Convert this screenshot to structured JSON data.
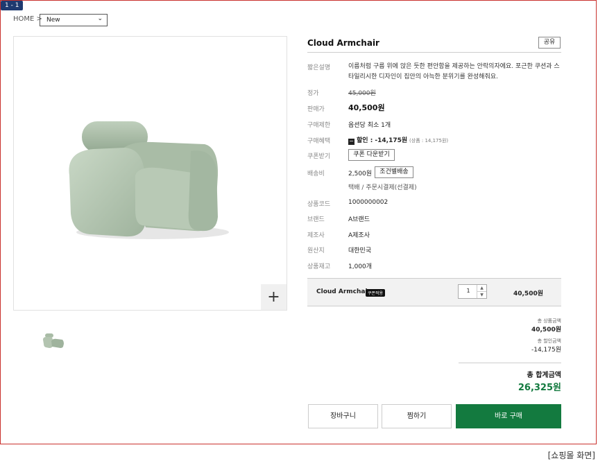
{
  "screen_tag": "1 - 1",
  "caption": "[쇼핑몰 화면]",
  "breadcrumb": {
    "home": "HOME >",
    "category": "New"
  },
  "product": {
    "title": "Cloud Armchair",
    "share_label": "공유",
    "rows": {
      "desc_label": "짧은설명",
      "desc": "이름처럼 구름 위에 앉은 듯한 편안함을 제공하는 안락의자에요. 포근한 쿠션과 스타일리시한 디자인이 집안의 아늑한 분위기를 완성해줘요.",
      "list_price_label": "정가",
      "list_price": "45,000원",
      "sale_price_label": "판매가",
      "sale_price": "40,500원",
      "limit_label": "구매제한",
      "limit": "옵션당 최소 1개",
      "benefit_label": "구매혜택",
      "benefit": "할인 : -14,175원",
      "benefit_detail": "(상품 : 14,175원)",
      "coupon_label": "쿠폰받기",
      "coupon_button": "쿠폰 다운받기",
      "shipping_label": "배송비",
      "shipping_fee": "2,500원",
      "shipping_button": "조건별배송",
      "shipping_method": "택배  / 주문시결제(선결제)",
      "code_label": "상품코드",
      "code": "1000000002",
      "brand_label": "브랜드",
      "brand": "A브랜드",
      "maker_label": "제조사",
      "maker": "A제조사",
      "origin_label": "원산지",
      "origin": "대한민국",
      "stock_label": "상품재고",
      "stock": "1,000개"
    }
  },
  "option": {
    "name": "Cloud Armchair",
    "badge": "쿠폰적용",
    "qty": "1",
    "price": "40,500원"
  },
  "summary": {
    "product_total_label": "총 상품금액",
    "product_total": "40,500원",
    "discount_label": "총 할인금액",
    "discount": "-14,175원",
    "grand_total_label": "총 합계금액",
    "grand_total": "26,325원"
  },
  "buttons": {
    "cart": "장바구니",
    "wish": "찜하기",
    "buy": "바로 구매"
  },
  "colors": {
    "accent": "#137a3f",
    "frame": "#c9302c",
    "tag": "#1f3a70"
  },
  "icons": {
    "zoom": "plus-icon",
    "select": "chevron-down-icon"
  }
}
